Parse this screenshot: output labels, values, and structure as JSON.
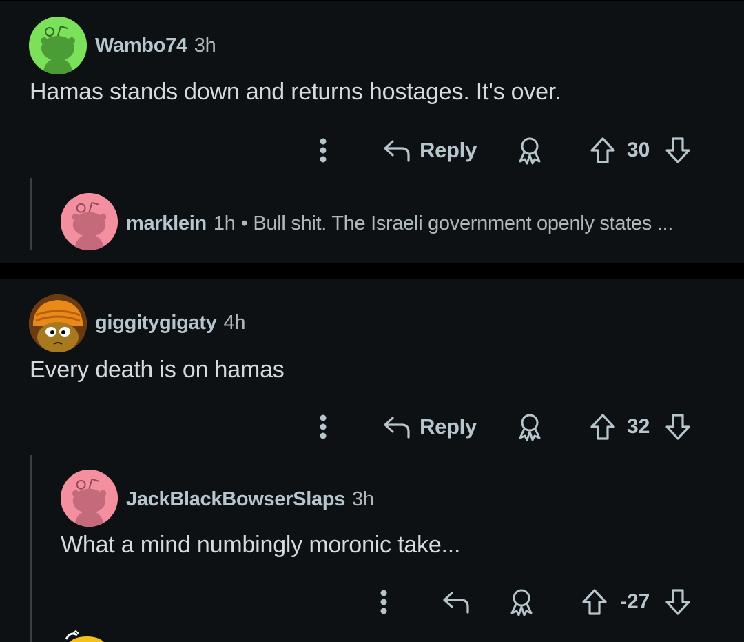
{
  "comments": [
    {
      "username": "Wambo74",
      "time": "3h",
      "text": "Hamas stands down and returns hostages. It's over.",
      "reply_label": "Reply",
      "score": "30",
      "avatar_color": "#7be05a",
      "reply": {
        "username": "marklein",
        "time": "1h",
        "separator": "•",
        "preview": "Bull shit. The Israeli government openly states ...",
        "avatar_color": "#f48fa0"
      }
    },
    {
      "username": "giggitygigaty",
      "time": "4h",
      "text": "Every death is on hamas",
      "reply_label": "Reply",
      "score": "32",
      "avatar_color": "#e07a18",
      "reply": {
        "username": "JackBlackBowserSlaps",
        "time": "3h",
        "text": "What a mind numbingly moronic take...",
        "score": "-27",
        "avatar_color": "#f48fa0"
      }
    }
  ],
  "colors": {
    "background": "#0e1113",
    "separator": "#000000",
    "icon": "#b7c5cc",
    "thread_line": "#3a3f43"
  }
}
